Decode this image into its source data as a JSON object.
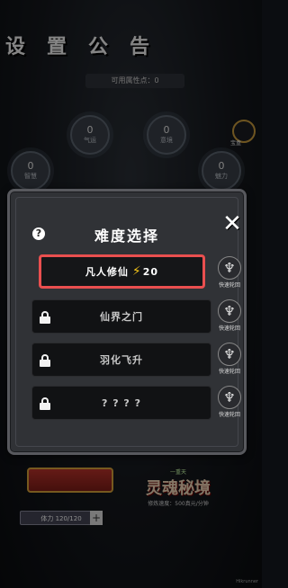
{
  "background": {
    "header_chars": [
      "设",
      "置",
      "公",
      "告"
    ],
    "attribute_points": "可用属性点：0",
    "orbs": [
      {
        "value": "0",
        "label": "气运"
      },
      {
        "value": "0",
        "label": "意境"
      },
      {
        "value": "0",
        "label": "智慧"
      },
      {
        "value": "0",
        "label": "魅力"
      }
    ],
    "side_label": "宝盒",
    "realm": {
      "top": "一重天",
      "name": "灵魂秘境",
      "speed": "修炼速度：500真元/分钟"
    },
    "stamina": "体力 120/120",
    "stamina_plus": "+",
    "corner_text": "Hikrunner"
  },
  "modal": {
    "title": "难度选择",
    "help_icon": "?",
    "close_icon": "✕",
    "rows": [
      {
        "label": "凡人修仙",
        "cost": "20",
        "locked": false,
        "quick_label": "快速轮回"
      },
      {
        "label": "仙界之门",
        "locked": true,
        "quick_label": "快速轮回"
      },
      {
        "label": "羽化飞升",
        "locked": true,
        "quick_label": "快速轮回"
      },
      {
        "label": "? ? ? ?",
        "locked": true,
        "quick_label": "快速轮回"
      }
    ],
    "colors": {
      "highlight": "#e94f4f",
      "bolt": "#f5c518"
    }
  }
}
